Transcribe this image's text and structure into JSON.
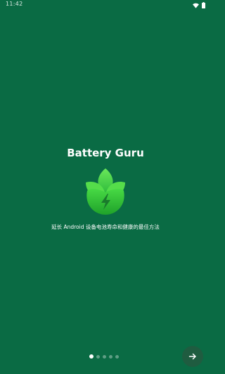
{
  "status_bar": {
    "time": "11:42",
    "icons": [
      "wifi-icon",
      "battery-icon"
    ]
  },
  "onboarding": {
    "title": "Battery Guru",
    "tagline": "延长 Android 设备电池寿命和健康的最佳方法",
    "logo_icon": "leaf-lightning-icon",
    "page_count": 5,
    "current_page": 1
  },
  "next_button": {
    "icon": "arrow-right-icon"
  },
  "colors": {
    "background": "#0a6b44",
    "logo_green": "#3fd43f",
    "logo_dark_green": "#1fa22a",
    "button_bg": "#1f5c40"
  }
}
